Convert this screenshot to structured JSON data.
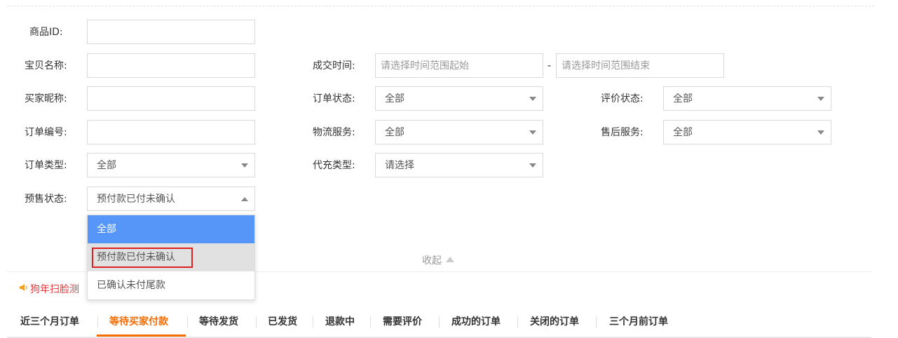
{
  "filters": {
    "product_id": {
      "label": "商品ID:"
    },
    "item_name": {
      "label": "宝贝名称:"
    },
    "buyer_nick": {
      "label": "买家昵称:"
    },
    "order_no": {
      "label": "订单编号:"
    },
    "order_type": {
      "label": "订单类型:",
      "value": "全部"
    },
    "presale_status": {
      "label": "预售状态:",
      "value": "预付款已付未确认"
    },
    "deal_time": {
      "label": "成交时间:",
      "start_placeholder": "请选择时间范围起始",
      "separator": "-",
      "end_placeholder": "请选择时间范围结束"
    },
    "order_status": {
      "label": "订单状态:",
      "value": "全部"
    },
    "logistics": {
      "label": "物流服务:",
      "value": "全部"
    },
    "recharge_type": {
      "label": "代充类型:",
      "value": "请选择"
    },
    "review_status": {
      "label": "评价状态:",
      "value": "全部"
    },
    "after_sale": {
      "label": "售后服务:",
      "value": "全部"
    }
  },
  "presale_dropdown": {
    "options": [
      "全部",
      "预付款已付未确认",
      "已确认未付尾款"
    ]
  },
  "collapse_label": "收起",
  "notice_text": "狗年扫脸测",
  "tabs": [
    "近三个月订单",
    "等待买家付款",
    "等待发货",
    "已发货",
    "退款中",
    "需要评价",
    "成功的订单",
    "关闭的订单",
    "三个月前订单"
  ],
  "colors": {
    "accent": "#f56c00",
    "dropdown_selected": "#5596f8",
    "highlight_box": "#e02020"
  }
}
